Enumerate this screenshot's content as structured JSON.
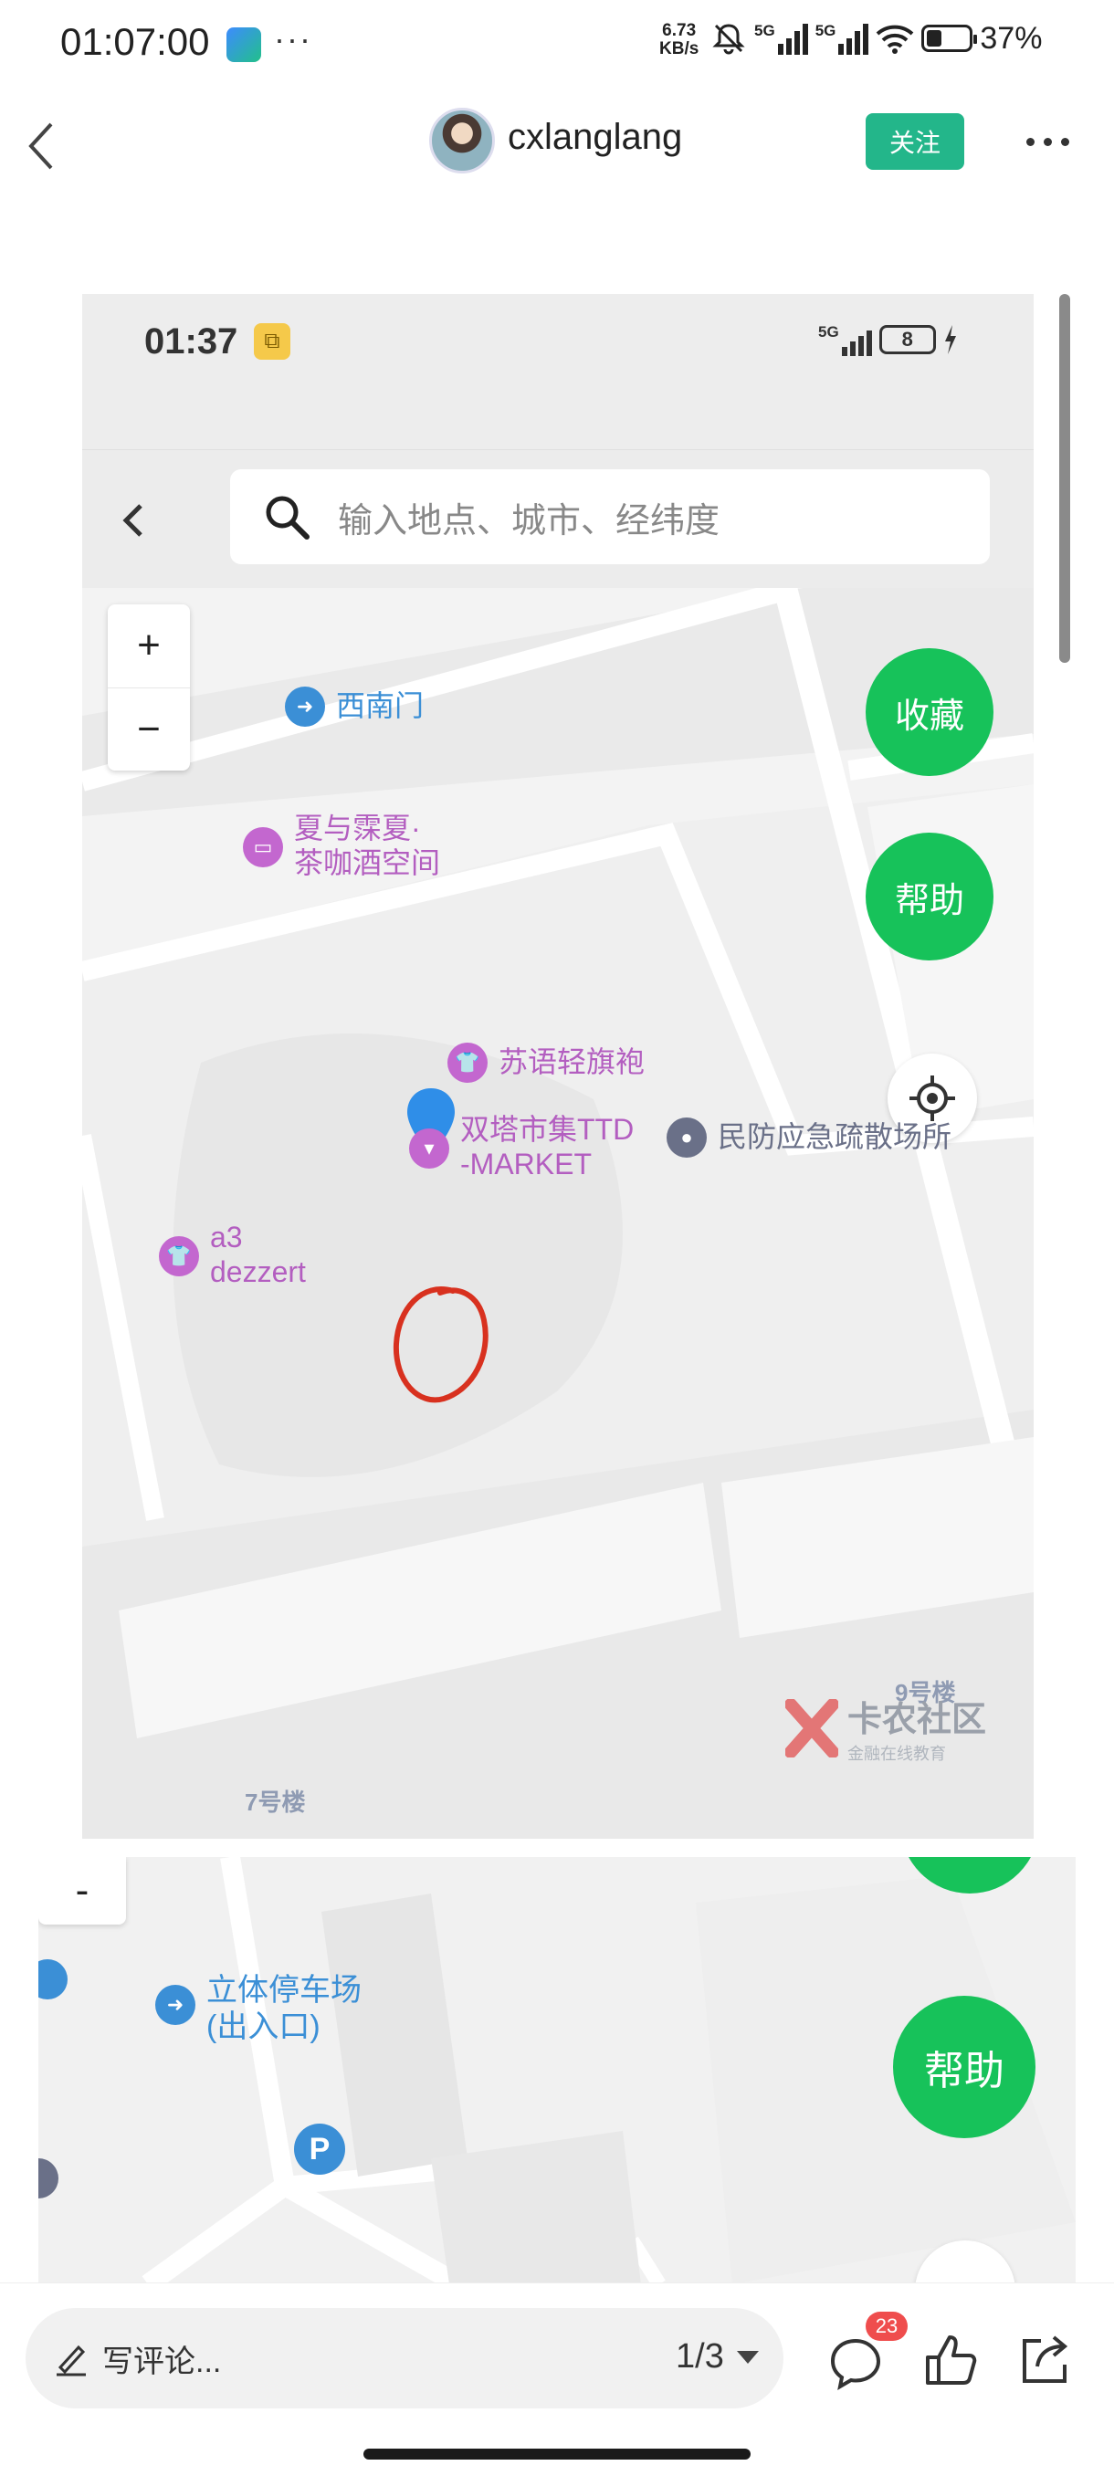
{
  "status_bar": {
    "time": "01:07:00",
    "more": "···",
    "net_speed": "6.73",
    "net_unit": "KB/s",
    "sim1": "5G",
    "sim2": "5G",
    "battery": "37%"
  },
  "header": {
    "username": "cxlanglang",
    "follow_label": "关注"
  },
  "shot1": {
    "status_time": "01:37",
    "status_net": "5G",
    "status_battery": "8",
    "search_placeholder": "输入地点、城市、经纬度",
    "zoom_in": "+",
    "zoom_out": "−",
    "favorite_label": "收藏",
    "help_label": "帮助",
    "pois": {
      "southwest_gate": "西南门",
      "teahouse_line1": "夏与霂夏·",
      "teahouse_line2": "茶咖酒空间",
      "suyu": "苏语轻旗袍",
      "market_line1": "双塔市集TTD",
      "market_line2": "-MARKET",
      "civil_defense": "民防应急疏散场所",
      "a3_line1": "a3",
      "a3_line2": "dezzert"
    },
    "building_9": "9号楼",
    "building_7": "7号楼",
    "watermark_main": "卡农社区",
    "watermark_sub": "金融在线教育"
  },
  "shot2": {
    "zoom_out": "-",
    "parking_line1": "立体停车场",
    "parking_line2": "(出入口)",
    "parking_icon": "P",
    "help_label": "帮助"
  },
  "bottom_bar": {
    "comment_placeholder": "写评论...",
    "page_indicator": "1/3",
    "comment_count": "23"
  },
  "colors": {
    "accent_green": "#17c25a",
    "follow_green": "#23b68a",
    "badge_red": "#ef4d4d"
  }
}
